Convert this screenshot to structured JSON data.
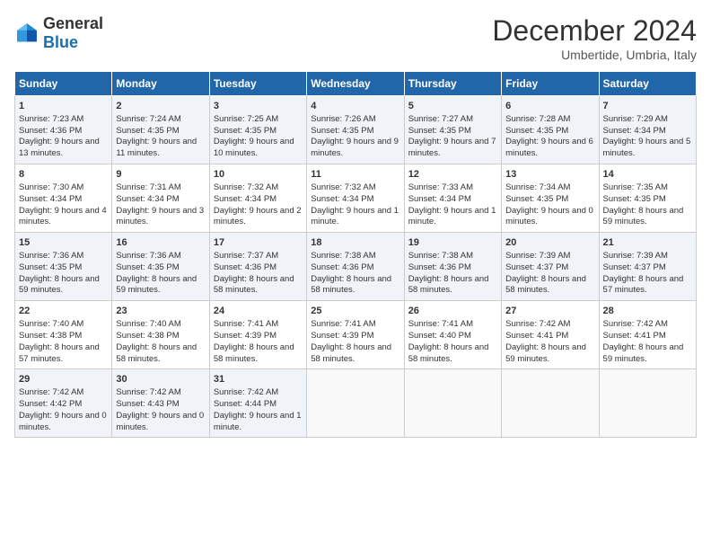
{
  "header": {
    "logo_general": "General",
    "logo_blue": "Blue",
    "month_title": "December 2024",
    "subtitle": "Umbertide, Umbria, Italy"
  },
  "days_of_week": [
    "Sunday",
    "Monday",
    "Tuesday",
    "Wednesday",
    "Thursday",
    "Friday",
    "Saturday"
  ],
  "weeks": [
    [
      {
        "day": "1",
        "info": "Sunrise: 7:23 AM\nSunset: 4:36 PM\nDaylight: 9 hours and 13 minutes."
      },
      {
        "day": "2",
        "info": "Sunrise: 7:24 AM\nSunset: 4:35 PM\nDaylight: 9 hours and 11 minutes."
      },
      {
        "day": "3",
        "info": "Sunrise: 7:25 AM\nSunset: 4:35 PM\nDaylight: 9 hours and 10 minutes."
      },
      {
        "day": "4",
        "info": "Sunrise: 7:26 AM\nSunset: 4:35 PM\nDaylight: 9 hours and 9 minutes."
      },
      {
        "day": "5",
        "info": "Sunrise: 7:27 AM\nSunset: 4:35 PM\nDaylight: 9 hours and 7 minutes."
      },
      {
        "day": "6",
        "info": "Sunrise: 7:28 AM\nSunset: 4:35 PM\nDaylight: 9 hours and 6 minutes."
      },
      {
        "day": "7",
        "info": "Sunrise: 7:29 AM\nSunset: 4:34 PM\nDaylight: 9 hours and 5 minutes."
      }
    ],
    [
      {
        "day": "8",
        "info": "Sunrise: 7:30 AM\nSunset: 4:34 PM\nDaylight: 9 hours and 4 minutes."
      },
      {
        "day": "9",
        "info": "Sunrise: 7:31 AM\nSunset: 4:34 PM\nDaylight: 9 hours and 3 minutes."
      },
      {
        "day": "10",
        "info": "Sunrise: 7:32 AM\nSunset: 4:34 PM\nDaylight: 9 hours and 2 minutes."
      },
      {
        "day": "11",
        "info": "Sunrise: 7:32 AM\nSunset: 4:34 PM\nDaylight: 9 hours and 1 minute."
      },
      {
        "day": "12",
        "info": "Sunrise: 7:33 AM\nSunset: 4:34 PM\nDaylight: 9 hours and 1 minute."
      },
      {
        "day": "13",
        "info": "Sunrise: 7:34 AM\nSunset: 4:35 PM\nDaylight: 9 hours and 0 minutes."
      },
      {
        "day": "14",
        "info": "Sunrise: 7:35 AM\nSunset: 4:35 PM\nDaylight: 8 hours and 59 minutes."
      }
    ],
    [
      {
        "day": "15",
        "info": "Sunrise: 7:36 AM\nSunset: 4:35 PM\nDaylight: 8 hours and 59 minutes."
      },
      {
        "day": "16",
        "info": "Sunrise: 7:36 AM\nSunset: 4:35 PM\nDaylight: 8 hours and 59 minutes."
      },
      {
        "day": "17",
        "info": "Sunrise: 7:37 AM\nSunset: 4:36 PM\nDaylight: 8 hours and 58 minutes."
      },
      {
        "day": "18",
        "info": "Sunrise: 7:38 AM\nSunset: 4:36 PM\nDaylight: 8 hours and 58 minutes."
      },
      {
        "day": "19",
        "info": "Sunrise: 7:38 AM\nSunset: 4:36 PM\nDaylight: 8 hours and 58 minutes."
      },
      {
        "day": "20",
        "info": "Sunrise: 7:39 AM\nSunset: 4:37 PM\nDaylight: 8 hours and 58 minutes."
      },
      {
        "day": "21",
        "info": "Sunrise: 7:39 AM\nSunset: 4:37 PM\nDaylight: 8 hours and 57 minutes."
      }
    ],
    [
      {
        "day": "22",
        "info": "Sunrise: 7:40 AM\nSunset: 4:38 PM\nDaylight: 8 hours and 57 minutes."
      },
      {
        "day": "23",
        "info": "Sunrise: 7:40 AM\nSunset: 4:38 PM\nDaylight: 8 hours and 58 minutes."
      },
      {
        "day": "24",
        "info": "Sunrise: 7:41 AM\nSunset: 4:39 PM\nDaylight: 8 hours and 58 minutes."
      },
      {
        "day": "25",
        "info": "Sunrise: 7:41 AM\nSunset: 4:39 PM\nDaylight: 8 hours and 58 minutes."
      },
      {
        "day": "26",
        "info": "Sunrise: 7:41 AM\nSunset: 4:40 PM\nDaylight: 8 hours and 58 minutes."
      },
      {
        "day": "27",
        "info": "Sunrise: 7:42 AM\nSunset: 4:41 PM\nDaylight: 8 hours and 59 minutes."
      },
      {
        "day": "28",
        "info": "Sunrise: 7:42 AM\nSunset: 4:41 PM\nDaylight: 8 hours and 59 minutes."
      }
    ],
    [
      {
        "day": "29",
        "info": "Sunrise: 7:42 AM\nSunset: 4:42 PM\nDaylight: 9 hours and 0 minutes."
      },
      {
        "day": "30",
        "info": "Sunrise: 7:42 AM\nSunset: 4:43 PM\nDaylight: 9 hours and 0 minutes."
      },
      {
        "day": "31",
        "info": "Sunrise: 7:42 AM\nSunset: 4:44 PM\nDaylight: 9 hours and 1 minute."
      },
      null,
      null,
      null,
      null
    ]
  ]
}
